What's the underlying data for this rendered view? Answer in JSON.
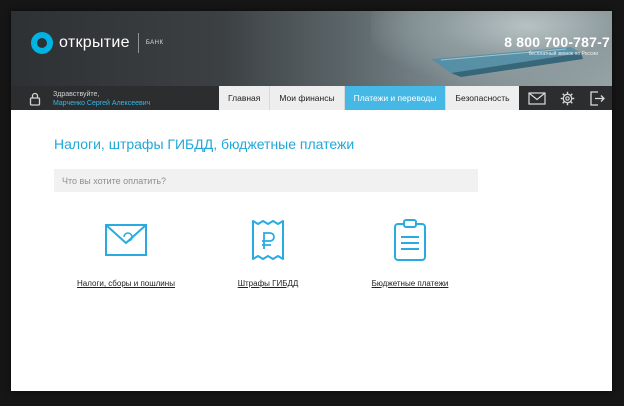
{
  "colors": {
    "accent": "#45b8e5",
    "title_blue": "#21a8da",
    "nav_bg": "#2b2d2f",
    "icon_blue": "#29abe2"
  },
  "brand": {
    "name": "открытие",
    "sub": "БАНК",
    "logo_icon": "otkritie-logo-icon"
  },
  "contact": {
    "phone": "8 800 700-787-7",
    "note": "бесплатный звонок по России"
  },
  "user": {
    "greeting": "Здравствуйте,",
    "name": "Марченко Сергей Алексеевич",
    "icon": "lock-icon"
  },
  "nav": {
    "tabs": [
      {
        "label": "Главная",
        "active": false
      },
      {
        "label": "Мои финансы",
        "active": false
      },
      {
        "label": "Платежи и переводы",
        "active": true
      },
      {
        "label": "Безопасность",
        "active": false
      }
    ],
    "icons": [
      "mail-icon",
      "gear-icon",
      "logout-icon"
    ]
  },
  "main": {
    "title": "Налоги, штрафы ГИБДД, бюджетные платежи",
    "search": {
      "placeholder": "Что вы хотите оплатить?",
      "value": ""
    },
    "categories": [
      {
        "label": "Налоги, сборы и пошлины",
        "icon": "envelope-icon"
      },
      {
        "label": "Штрафы ГИБДД",
        "icon": "receipt-ruble-icon"
      },
      {
        "label": "Бюджетные платежи",
        "icon": "clipboard-icon"
      }
    ]
  }
}
